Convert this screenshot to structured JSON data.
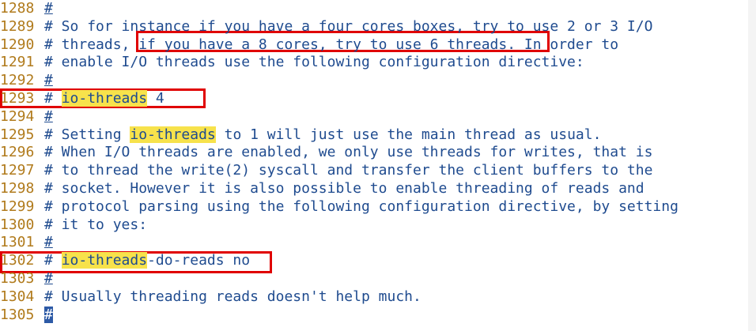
{
  "editor": {
    "lines": [
      {
        "n": "1288",
        "hash": "#",
        "segments": [
          {
            "t": "",
            "k": "txt"
          }
        ]
      },
      {
        "n": "1289",
        "hash": "#",
        "segments": [
          {
            "t": " So for instance if you have a four cores boxes, try to use 2 or 3 I/O",
            "k": "txt"
          }
        ]
      },
      {
        "n": "1290",
        "hash": "#",
        "segments": [
          {
            "t": " threads, if you have a 8 cores, try to use 6 threads. In order to",
            "k": "txt"
          }
        ]
      },
      {
        "n": "1291",
        "hash": "#",
        "segments": [
          {
            "t": " enable I/O threads use the following configuration directive:",
            "k": "txt"
          }
        ]
      },
      {
        "n": "1292",
        "hash": "#",
        "segments": [
          {
            "t": "",
            "k": "txt"
          }
        ]
      },
      {
        "n": "1293",
        "hash": "#",
        "segments": [
          {
            "t": " ",
            "k": "txt"
          },
          {
            "t": "io-threads",
            "k": "hl"
          },
          {
            "t": " 4",
            "k": "txt"
          }
        ]
      },
      {
        "n": "1294",
        "hash": "#",
        "segments": [
          {
            "t": "",
            "k": "txt"
          }
        ]
      },
      {
        "n": "1295",
        "hash": "#",
        "segments": [
          {
            "t": " Setting ",
            "k": "txt"
          },
          {
            "t": "io-threads",
            "k": "hl"
          },
          {
            "t": " to 1 will just use the main thread as usual.",
            "k": "txt"
          }
        ]
      },
      {
        "n": "1296",
        "hash": "#",
        "segments": [
          {
            "t": " When I/O threads are enabled, we only use threads for writes, that is",
            "k": "txt"
          }
        ]
      },
      {
        "n": "1297",
        "hash": "#",
        "segments": [
          {
            "t": " to thread the write(2) syscall and transfer the client buffers to the",
            "k": "txt"
          }
        ]
      },
      {
        "n": "1298",
        "hash": "#",
        "segments": [
          {
            "t": " socket. However it is also possible to enable threading of reads and",
            "k": "txt"
          }
        ]
      },
      {
        "n": "1299",
        "hash": "#",
        "segments": [
          {
            "t": " protocol parsing using the following configuration directive, by setting",
            "k": "txt"
          }
        ]
      },
      {
        "n": "1300",
        "hash": "#",
        "segments": [
          {
            "t": " it to yes:",
            "k": "txt"
          }
        ]
      },
      {
        "n": "1301",
        "hash": "#",
        "segments": [
          {
            "t": "",
            "k": "txt"
          }
        ]
      },
      {
        "n": "1302",
        "hash": "#",
        "segments": [
          {
            "t": " ",
            "k": "txt"
          },
          {
            "t": "io-threads",
            "k": "hl"
          },
          {
            "t": "-do-reads no",
            "k": "txt"
          }
        ]
      },
      {
        "n": "1303",
        "hash": "#",
        "segments": [
          {
            "t": "",
            "k": "txt"
          }
        ]
      },
      {
        "n": "1304",
        "hash": "#",
        "segments": [
          {
            "t": " Usually threading reads doesn't help much.",
            "k": "txt"
          }
        ]
      },
      {
        "n": "1305",
        "hash": "#",
        "segments": [
          {
            "t": "",
            "k": "txt"
          }
        ]
      }
    ],
    "cursor_line": "1305",
    "colors": {
      "line_number": "#b07a1b",
      "comment_text": "#1f4b8f",
      "search_highlight": "#f7e24b",
      "annotation_box": "#e00000",
      "cursor": "#2d5aa6"
    }
  }
}
